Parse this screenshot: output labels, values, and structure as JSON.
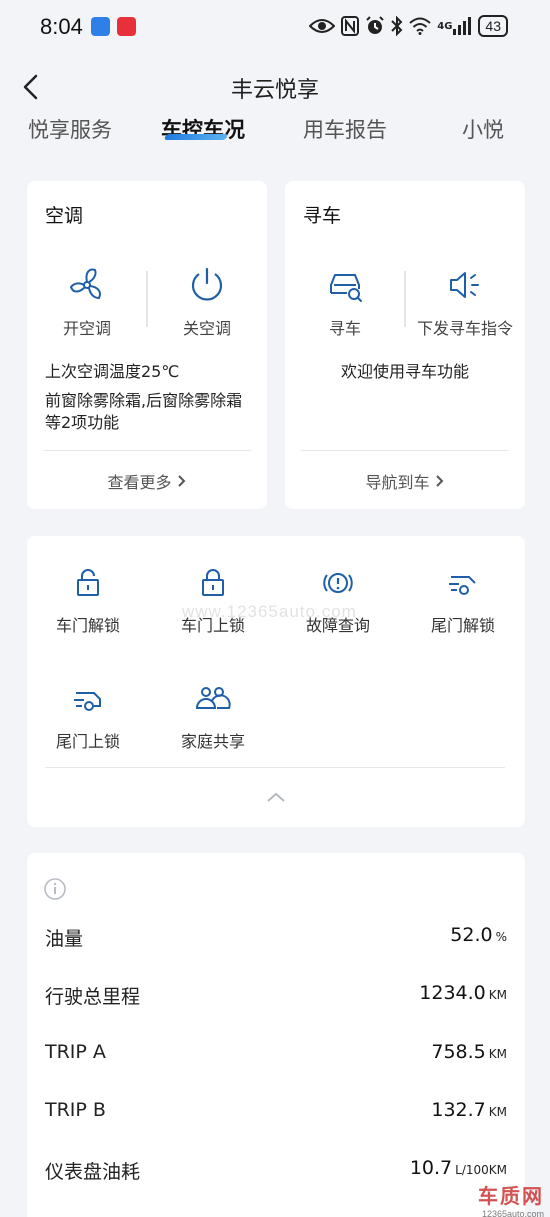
{
  "status_bar": {
    "time": "8:04",
    "battery": "43",
    "network": "4G"
  },
  "header": {
    "title": "丰云悦享"
  },
  "tabs": [
    {
      "label": "悦享服务"
    },
    {
      "label": "车控车况"
    },
    {
      "label": "用车报告"
    },
    {
      "label": "小悦"
    }
  ],
  "ac_card": {
    "title": "空调",
    "on_label": "开空调",
    "off_label": "关空调",
    "last_temp": "上次空调温度25℃",
    "defrost_desc": "前窗除雾除霜,后窗除雾除霜等2项功能",
    "more_label": "查看更多"
  },
  "find_car_card": {
    "title": "寻车",
    "find_label": "寻车",
    "send_label": "下发寻车指令",
    "welcome": "欢迎使用寻车功能",
    "navigate_label": "导航到车"
  },
  "controls": {
    "items": [
      {
        "label": "车门解锁",
        "icon": "door-unlock-icon"
      },
      {
        "label": "车门上锁",
        "icon": "door-lock-icon"
      },
      {
        "label": "故障查询",
        "icon": "fault-query-icon"
      },
      {
        "label": "尾门解锁",
        "icon": "tailgate-unlock-icon"
      },
      {
        "label": "尾门上锁",
        "icon": "tailgate-lock-icon"
      },
      {
        "label": "家庭共享",
        "icon": "family-share-icon"
      }
    ],
    "collapse_icon": "chevron-up-icon"
  },
  "vehicle_status": {
    "rows": [
      {
        "label": "油量",
        "value": "52.0",
        "unit": "%"
      },
      {
        "label": "行驶总里程",
        "value": "1234.0",
        "unit": "KM"
      },
      {
        "label": "TRIP A",
        "value": "758.5",
        "unit": "KM"
      },
      {
        "label": "TRIP B",
        "value": "132.7",
        "unit": "KM"
      },
      {
        "label": "仪表盘油耗",
        "value": "10.7",
        "unit": "L/100KM"
      }
    ]
  },
  "watermark": {
    "text": "www.12365auto.com",
    "corner_main": "车质网",
    "corner_sub": "12365auto.com"
  },
  "colors": {
    "accent": "#1f5fa8",
    "background": "#f3f4f7",
    "card": "#ffffff"
  }
}
